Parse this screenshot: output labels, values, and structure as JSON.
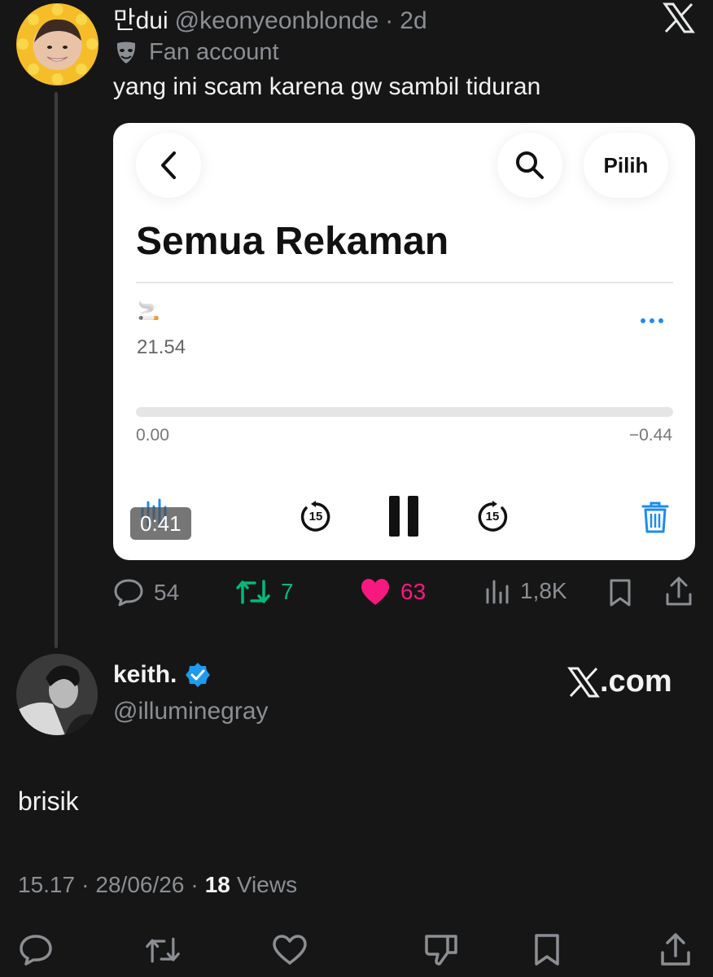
{
  "original_tweet": {
    "display_name": "만dui",
    "handle": "@keonyeonblonde",
    "separator": "·",
    "time_ago": "2d",
    "label": "Fan account",
    "text": "yang ini scam karena gw sambil tiduran",
    "x_logo_icon": "x-logo-icon",
    "media": {
      "back_icon": "chevron-left-icon",
      "search_icon": "search-icon",
      "select_label": "Pilih",
      "title": "Semua Rekaman",
      "recording_emoji": "🚬",
      "recording_time": "21.54",
      "more_icon": "more-dots-icon",
      "progress_fraction": 0.0,
      "elapsed": "0.00",
      "remaining": "−0.44",
      "skip_back_label": "15",
      "skip_forward_label": "15",
      "pause_icon": "pause-icon",
      "trash_icon": "trash-icon",
      "waveform_icon": "waveform-icon",
      "video_duration": "0:41",
      "accent_color": "#1d8cf0"
    },
    "stats": {
      "replies": "54",
      "reposts": "7",
      "likes": "63",
      "views": "1,8K"
    },
    "colors": {
      "repost_green": "#00ba7c",
      "like_pink": "#f91880"
    }
  },
  "reply": {
    "display_name": "keith.",
    "verified_icon": "verified-badge-icon",
    "handle": "@illuminegray",
    "watermark": "X.com",
    "text": "brisik",
    "time": "15.17",
    "separator": "·",
    "date": "28/06/26",
    "view_count": "18",
    "views_label": "Views"
  },
  "bottom_actions": [
    "reply-icon",
    "repost-icon",
    "like-icon",
    "dislike-icon",
    "bookmark-icon",
    "share-icon"
  ]
}
